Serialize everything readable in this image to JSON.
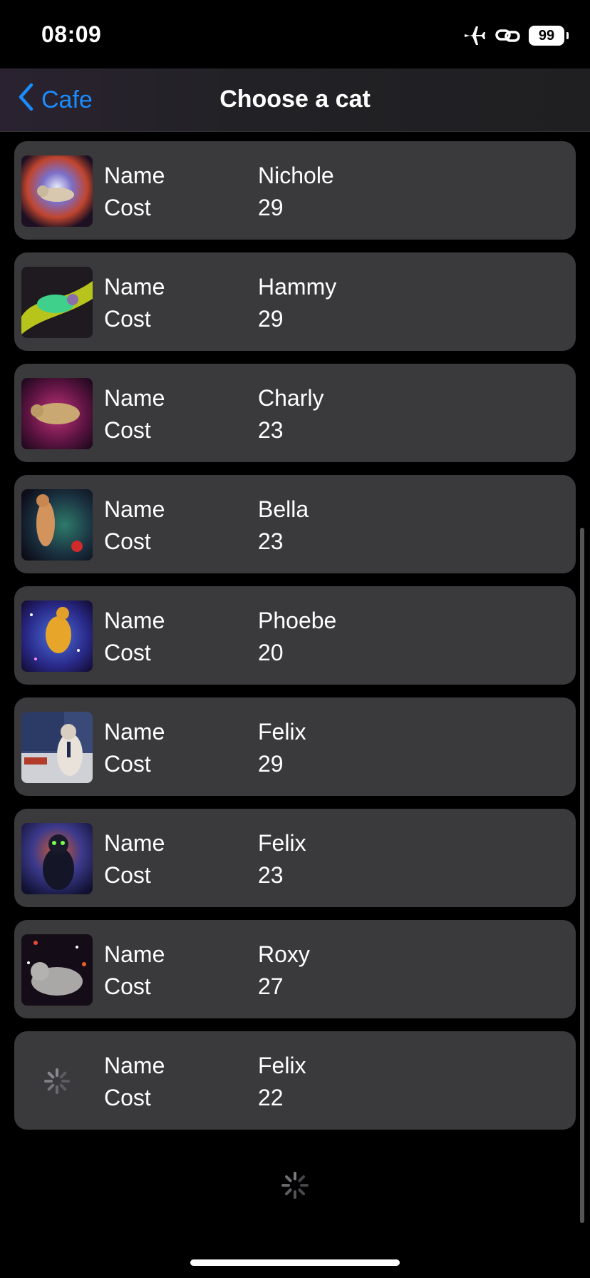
{
  "status": {
    "time": "08:09",
    "battery": "99"
  },
  "nav": {
    "back_label": "Cafe",
    "title": "Choose a cat"
  },
  "cats": [
    {
      "name_label": "Name",
      "cost_label": "Cost",
      "name": "Nichole",
      "cost": "29"
    },
    {
      "name_label": "Name",
      "cost_label": "Cost",
      "name": "Hammy",
      "cost": "29"
    },
    {
      "name_label": "Name",
      "cost_label": "Cost",
      "name": "Charly",
      "cost": "23"
    },
    {
      "name_label": "Name",
      "cost_label": "Cost",
      "name": "Bella",
      "cost": "23"
    },
    {
      "name_label": "Name",
      "cost_label": "Cost",
      "name": "Phoebe",
      "cost": "20"
    },
    {
      "name_label": "Name",
      "cost_label": "Cost",
      "name": "Felix",
      "cost": "29"
    },
    {
      "name_label": "Name",
      "cost_label": "Cost",
      "name": "Felix",
      "cost": "23"
    },
    {
      "name_label": "Name",
      "cost_label": "Cost",
      "name": "Roxy",
      "cost": "27"
    },
    {
      "name_label": "Name",
      "cost_label": "Cost",
      "name": "Felix",
      "cost": "22"
    }
  ],
  "icons": {
    "back": "chevron-left-icon",
    "airplane": "airplane-icon",
    "link": "link-icon",
    "spinner": "loading-spinner-icon"
  },
  "colors": {
    "accent": "#1a8cff",
    "row_bg": "#3a3a3c",
    "background": "#000000"
  }
}
